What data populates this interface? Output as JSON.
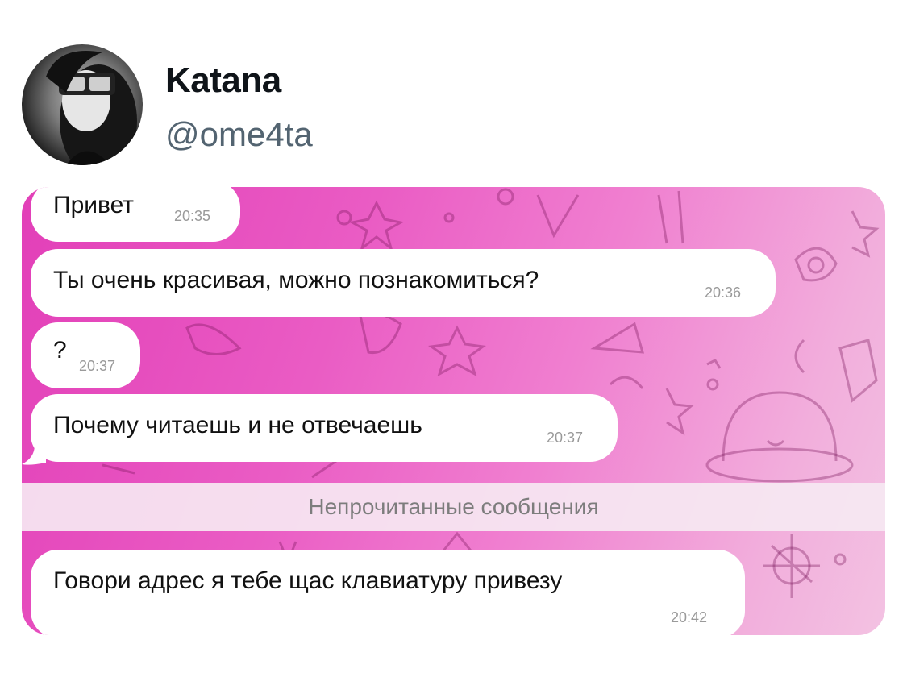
{
  "author": {
    "display_name": "Katana",
    "handle": "@ome4ta"
  },
  "chat": {
    "messages": [
      {
        "text": "Привет",
        "time": "20:35"
      },
      {
        "text": "Ты очень красивая, можно познакомиться?",
        "time": "20:36"
      },
      {
        "text": "?",
        "time": "20:37"
      },
      {
        "text": "Почему читаешь и не отвечаешь",
        "time": "20:37"
      },
      {
        "text": "Говори адрес я тебе щас клавиатуру привезу",
        "time": "20:42"
      }
    ],
    "unread_divider": "Непрочитанные сообщения",
    "colors": {
      "background_start": "#e23fb8",
      "background_end": "#f3c2e2",
      "bubble": "#ffffff"
    }
  }
}
